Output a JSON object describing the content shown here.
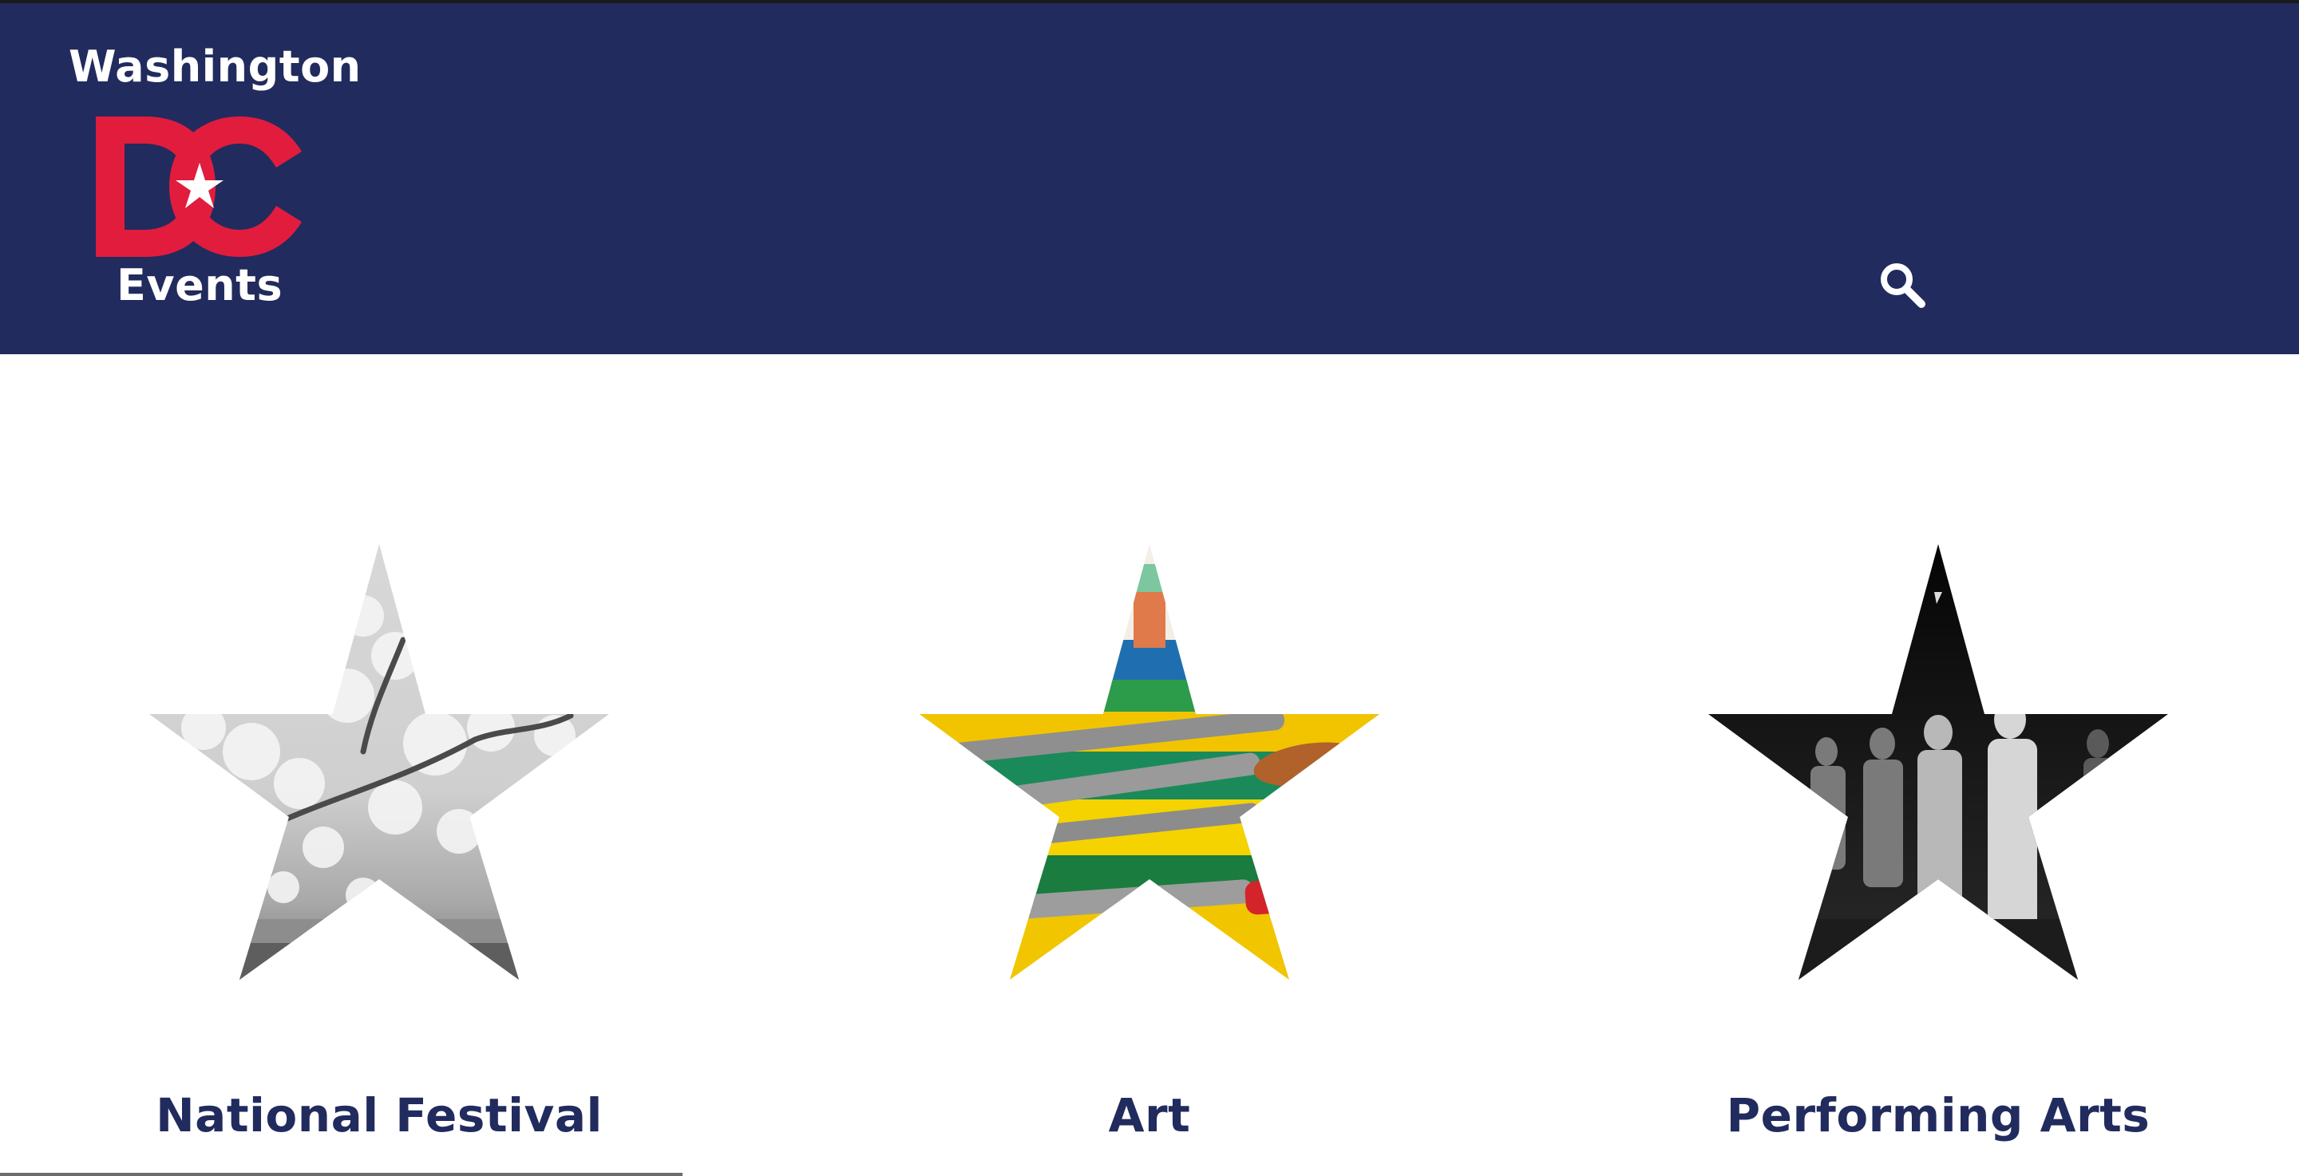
{
  "brand": {
    "top_text": "Washington",
    "mark_text": "DC",
    "bottom_text": "Events",
    "colors": {
      "header_bg": "#212b5e",
      "mark_red": "#e21c3d",
      "text": "#ffffff"
    }
  },
  "header": {
    "search_icon": "search-icon"
  },
  "categories": [
    {
      "label": "National Festival",
      "image": "cherry-blossom-photo"
    },
    {
      "label": "Art",
      "image": "paint-brushes-photo"
    },
    {
      "label": "Performing Arts",
      "image": "performers-photo"
    }
  ],
  "colors": {
    "accent_navy": "#212b5e",
    "accent_red": "#e21c3d",
    "background": "#ffffff"
  }
}
